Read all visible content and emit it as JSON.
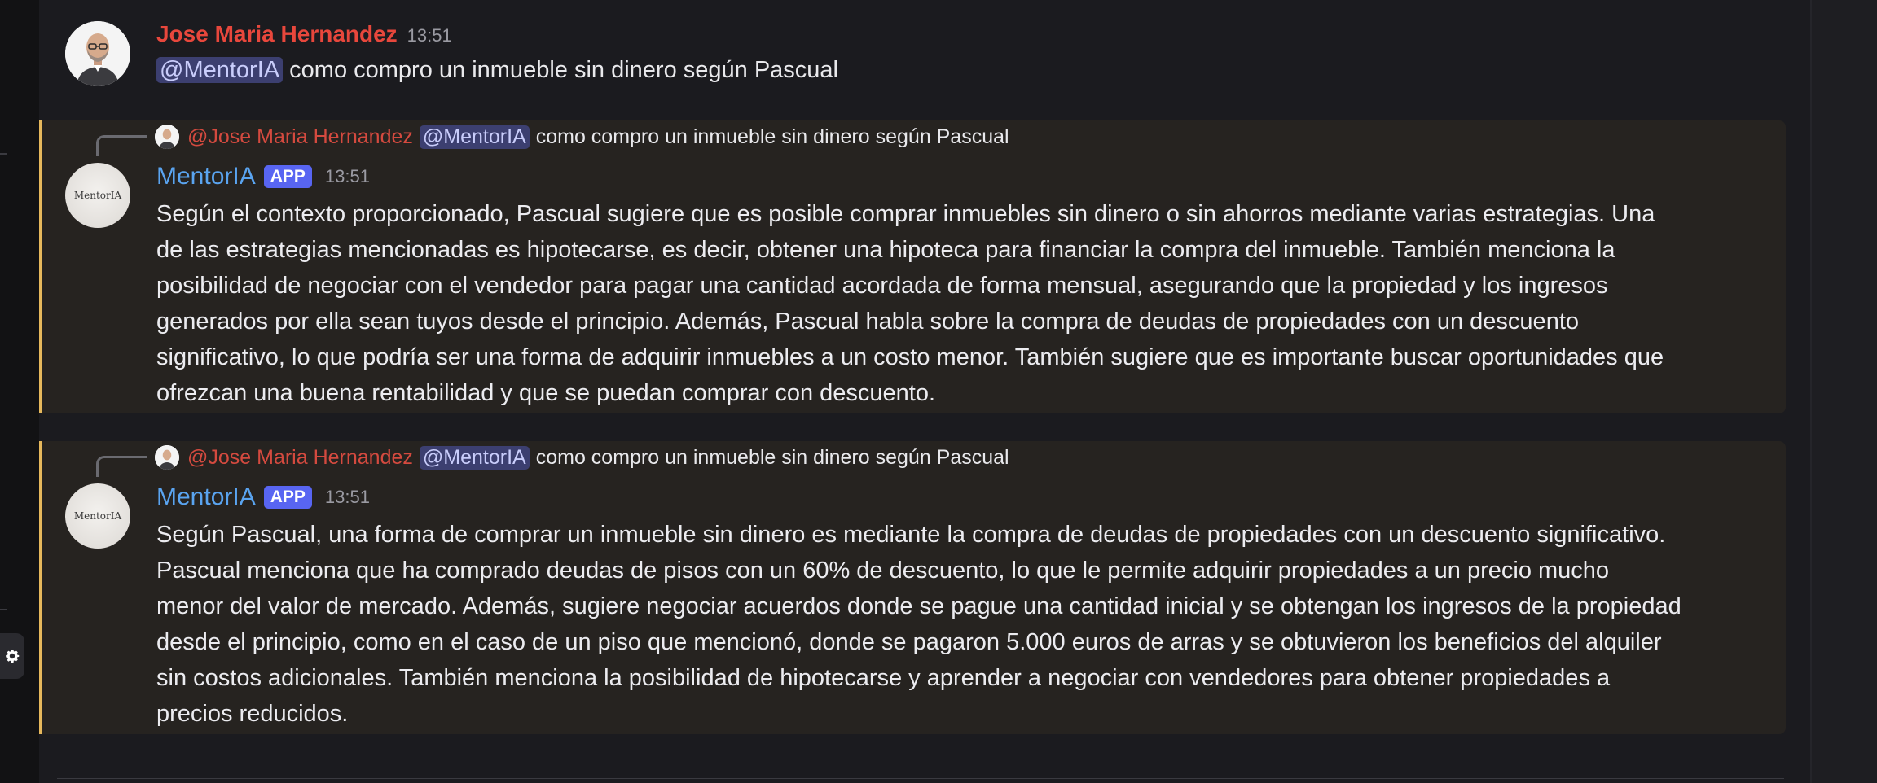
{
  "user_message": {
    "author": "Jose Maria Hernandez",
    "author_color": "#e8473c",
    "time": "13:51",
    "mention": "@MentorIA",
    "text": " como compro un inmueble sin dinero según Pascual"
  },
  "bot_replies": [
    {
      "reply_author": "@Jose Maria Hernandez",
      "reply_mention": "@MentorIA",
      "reply_text": "como compro un inmueble sin dinero según Pascual",
      "bot_name": "MentorIA",
      "bot_avatar_label": "MentorIA",
      "badge": "APP",
      "time": "13:51",
      "lines": [
        "Según el contexto proporcionado, Pascual sugiere que es posible comprar inmuebles sin dinero o sin ahorros mediante varias estrategias. Una",
        "de las estrategias mencionadas es hipotecarse, es decir, obtener una hipoteca para financiar la compra del inmueble. También menciona la",
        "posibilidad de negociar con el vendedor para pagar una cantidad acordada de forma mensual, asegurando que la propiedad y los ingresos",
        "generados por ella sean tuyos desde el principio. Además, Pascual habla sobre la compra de deudas de propiedades con un descuento",
        "significativo, lo que podría ser una forma de adquirir inmuebles a un costo menor. También sugiere que es importante buscar oportunidades que",
        "ofrezcan una buena rentabilidad y que se puedan comprar con descuento."
      ]
    },
    {
      "reply_author": "@Jose Maria Hernandez",
      "reply_mention": "@MentorIA",
      "reply_text": "como compro un inmueble sin dinero según Pascual",
      "bot_name": "MentorIA",
      "bot_avatar_label": "MentorIA",
      "badge": "APP",
      "time": "13:51",
      "lines": [
        "Según Pascual, una forma de comprar un inmueble sin dinero es mediante la compra de deudas de propiedades con un descuento significativo.",
        "Pascual menciona que ha comprado deudas de pisos con un 60% de descuento, lo que le permite adquirir propiedades a un precio mucho",
        "menor del valor de mercado. Además, sugiere negociar acuerdos donde se pague una cantidad inicial y se obtengan los ingresos de la propiedad",
        "desde el principio, como en el caso de un piso que mencionó, donde se pagaron 5.000 euros de arras y se obtuvieron los beneficios del alquiler",
        "sin costos adicionales. También menciona la posibilidad de hipotecarse y aprender a negociar con vendedores para obtener propiedades a",
        "precios reducidos."
      ]
    }
  ],
  "colors": {
    "background": "#1b1b1f",
    "bot_block": "#262320",
    "bot_name": "#5aa4f0",
    "badge": "#5865f2",
    "highlight_bar": "#e6b85c"
  },
  "icons": {
    "settings": "gear-icon"
  }
}
